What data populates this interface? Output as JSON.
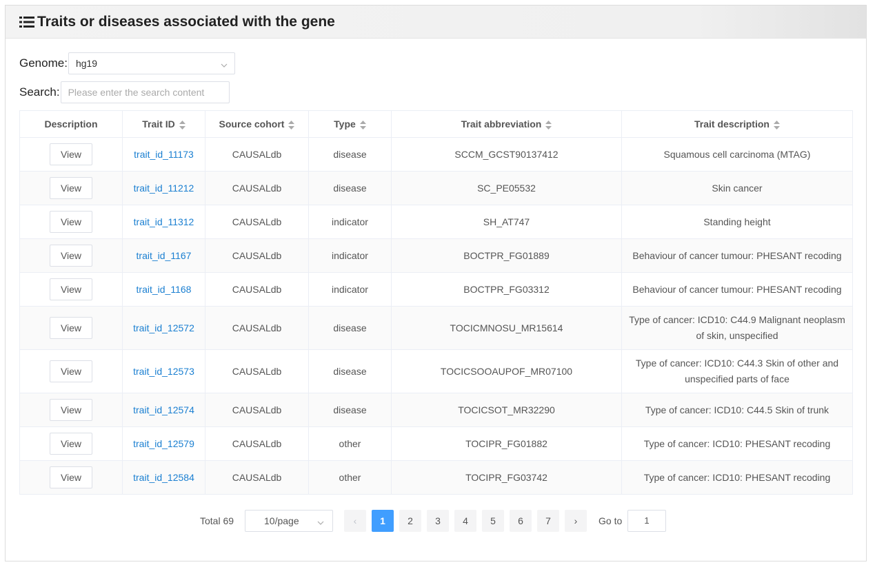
{
  "header": {
    "title": "Traits or diseases associated with the gene",
    "icon": "list-icon"
  },
  "genome": {
    "label": "Genome:",
    "value": "hg19"
  },
  "search": {
    "label": "Search:",
    "placeholder": "Please enter the search content",
    "value": ""
  },
  "table": {
    "columns": [
      "Description",
      "Trait ID",
      "Source cohort",
      "Type",
      "Trait abbreviation",
      "Trait description"
    ],
    "view_label": "View",
    "rows": [
      {
        "trait_id": "trait_id_11173",
        "cohort": "CAUSALdb",
        "type": "disease",
        "abbr": "SCCM_GCST90137412",
        "desc": "Squamous cell carcinoma (MTAG)"
      },
      {
        "trait_id": "trait_id_11212",
        "cohort": "CAUSALdb",
        "type": "disease",
        "abbr": "SC_PE05532",
        "desc": "Skin cancer"
      },
      {
        "trait_id": "trait_id_11312",
        "cohort": "CAUSALdb",
        "type": "indicator",
        "abbr": "SH_AT747",
        "desc": "Standing height"
      },
      {
        "trait_id": "trait_id_1167",
        "cohort": "CAUSALdb",
        "type": "indicator",
        "abbr": "BOCTPR_FG01889",
        "desc": "Behaviour of cancer tumour: PHESANT recoding"
      },
      {
        "trait_id": "trait_id_1168",
        "cohort": "CAUSALdb",
        "type": "indicator",
        "abbr": "BOCTPR_FG03312",
        "desc": "Behaviour of cancer tumour: PHESANT recoding"
      },
      {
        "trait_id": "trait_id_12572",
        "cohort": "CAUSALdb",
        "type": "disease",
        "abbr": "TOCICMNOSU_MR15614",
        "desc": "Type of cancer: ICD10: C44.9 Malignant neoplasm of skin, unspecified"
      },
      {
        "trait_id": "trait_id_12573",
        "cohort": "CAUSALdb",
        "type": "disease",
        "abbr": "TOCICSOOAUPOF_MR07100",
        "desc": "Type of cancer: ICD10: C44.3 Skin of other and unspecified parts of face"
      },
      {
        "trait_id": "trait_id_12574",
        "cohort": "CAUSALdb",
        "type": "disease",
        "abbr": "TOCICSOT_MR32290",
        "desc": "Type of cancer: ICD10: C44.5 Skin of trunk"
      },
      {
        "trait_id": "trait_id_12579",
        "cohort": "CAUSALdb",
        "type": "other",
        "abbr": "TOCIPR_FG01882",
        "desc": "Type of cancer: ICD10: PHESANT recoding"
      },
      {
        "trait_id": "trait_id_12584",
        "cohort": "CAUSALdb",
        "type": "other",
        "abbr": "TOCIPR_FG03742",
        "desc": "Type of cancer: ICD10: PHESANT recoding"
      }
    ]
  },
  "pagination": {
    "total": "Total 69",
    "page_size": "10/page",
    "pages": [
      "1",
      "2",
      "3",
      "4",
      "5",
      "6",
      "7"
    ],
    "current": "1",
    "prev": "‹",
    "next": "›",
    "goto_label": "Go to",
    "goto_value": "1"
  },
  "colors": {
    "accent": "#409eff",
    "link": "#1a7fd1"
  }
}
